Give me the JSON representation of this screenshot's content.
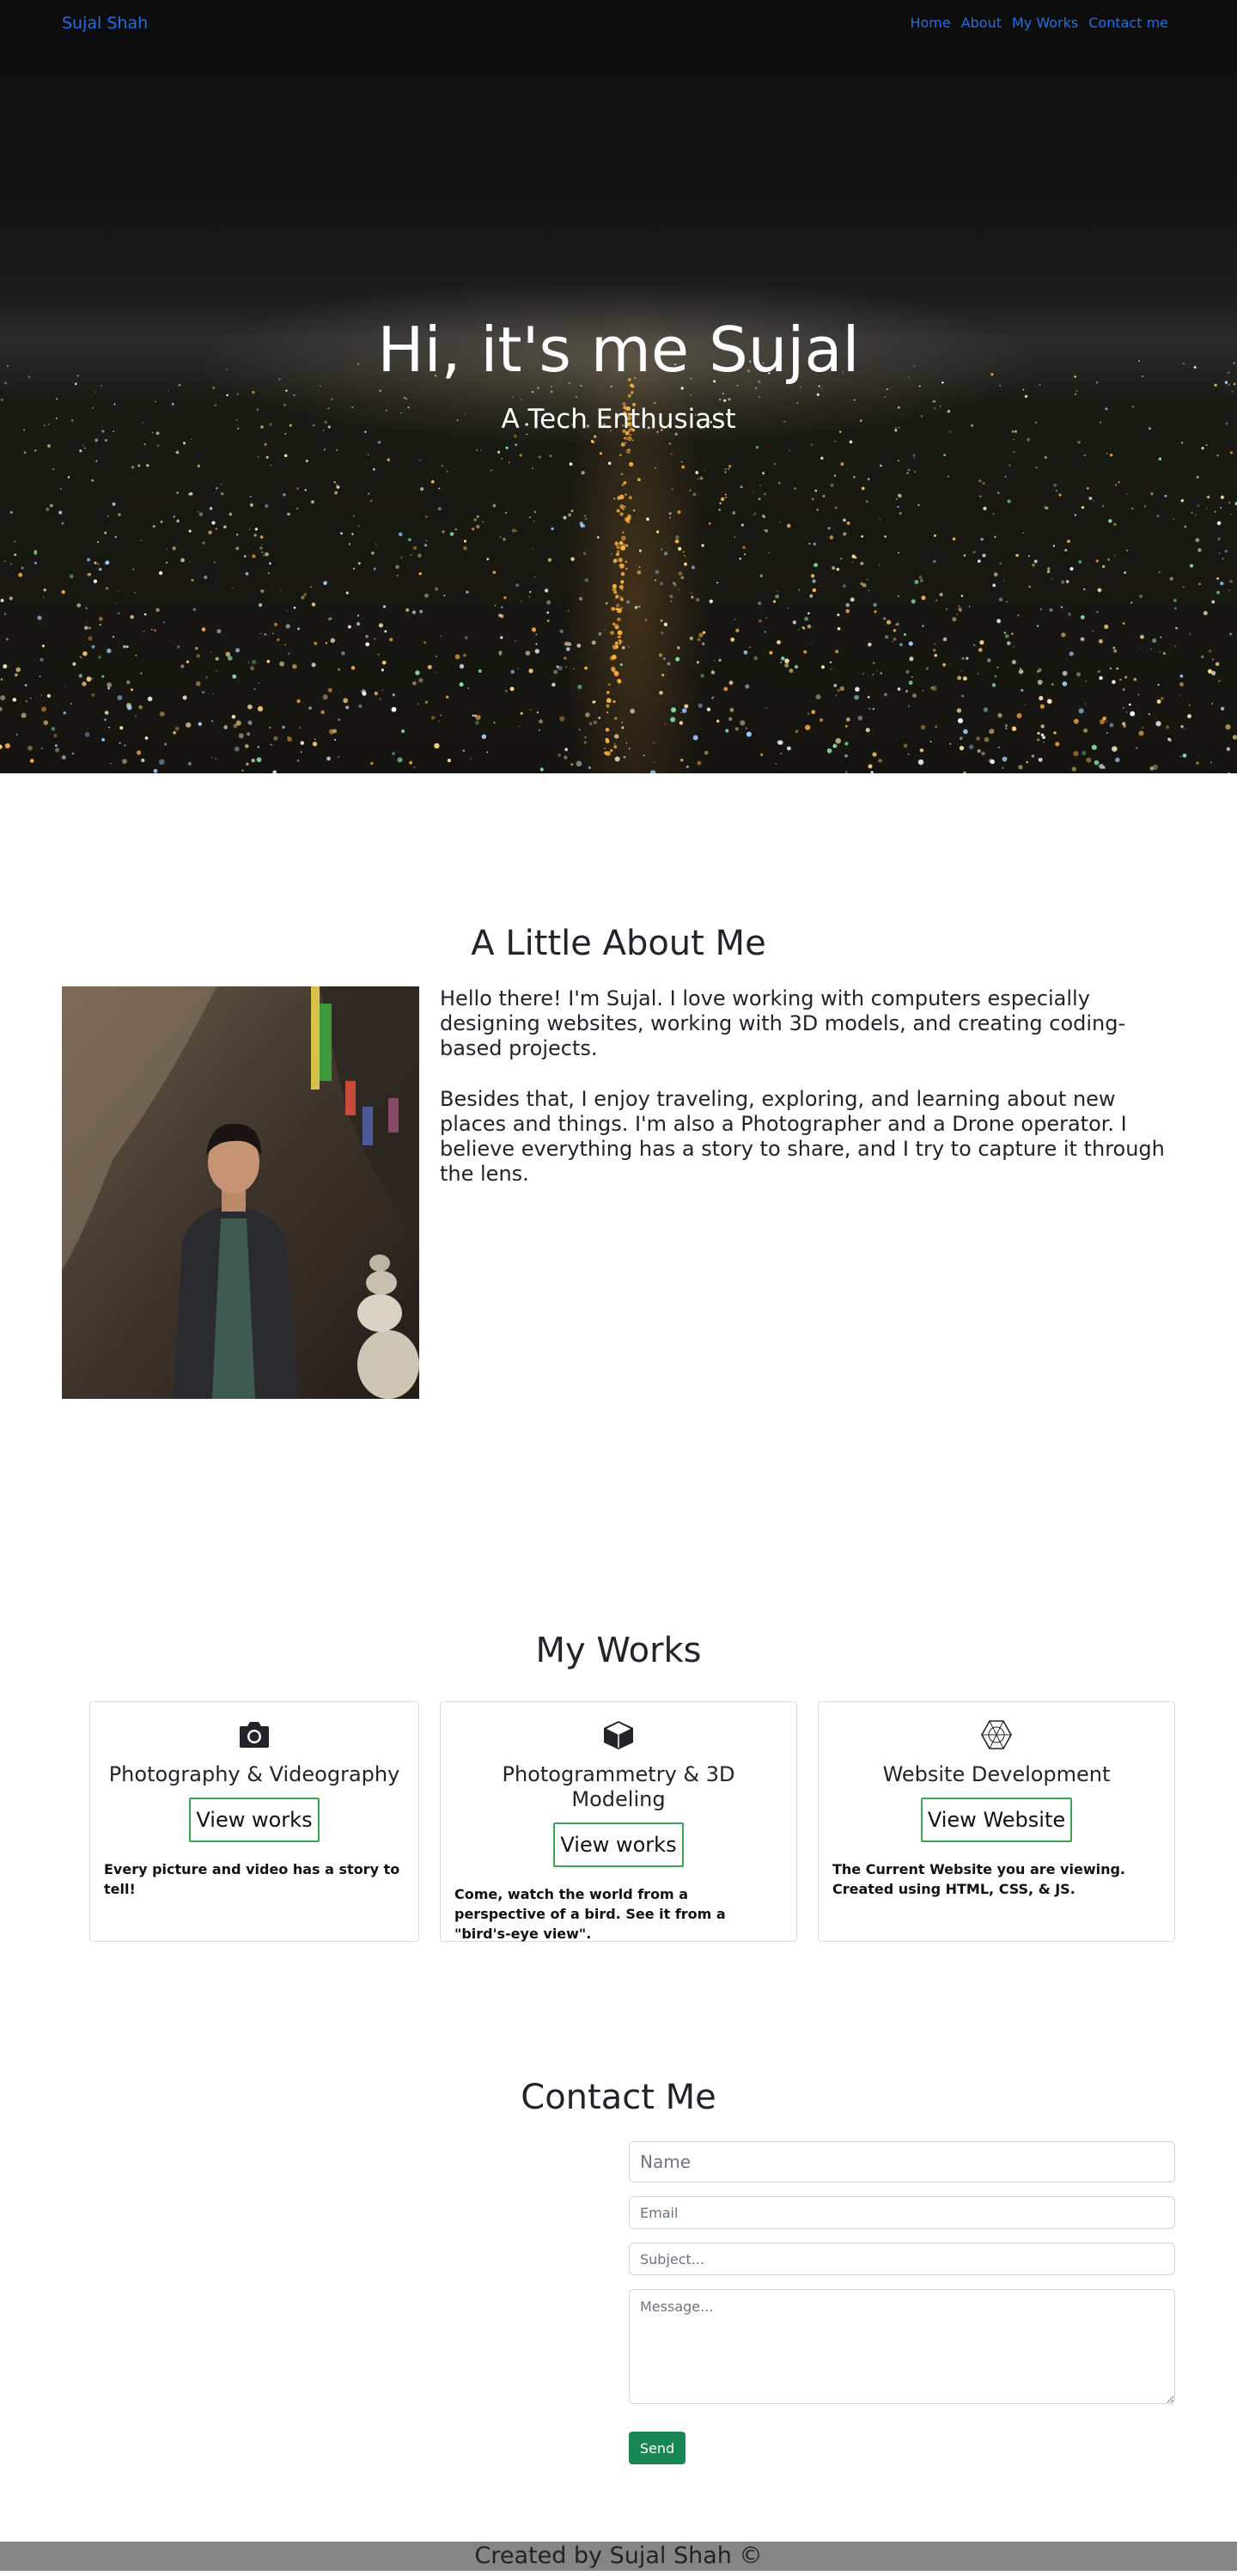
{
  "nav": {
    "brand": "Sujal Shah",
    "links": [
      "Home",
      "About",
      "My Works",
      "Contact me"
    ]
  },
  "hero": {
    "title": "Hi, it's me Sujal",
    "subtitle": "A Tech Enthusiast"
  },
  "about": {
    "title": "A Little About Me",
    "paragraphs": [
      "Hello there! I'm Sujal. I love working with computers especially designing websites, working with 3D models, and creating coding-based projects.",
      "Besides that, I enjoy traveling, exploring, and learning about new places and things. I'm also a Photographer and a Drone operator. I believe everything has a story to share, and I try to capture it through the lens."
    ]
  },
  "works": {
    "title": "My Works",
    "cards": [
      {
        "icon": "camera-icon",
        "title": "Photography & Videography",
        "button": "View works",
        "text": "Every picture and video has a story to tell!"
      },
      {
        "icon": "cube-icon",
        "title": "Photogrammetry & 3D Modeling",
        "button": "View works",
        "text": "Come, watch the world from a perspective of a bird. See it from a \"bird's-eye view\"."
      },
      {
        "icon": "web-icon",
        "title": "Website Development",
        "button": "View Website",
        "text": "The Current Website you are viewing. Created using HTML, CSS, & JS."
      }
    ]
  },
  "contact": {
    "title": "Contact Me",
    "name_placeholder": "Name",
    "email_placeholder": "Email",
    "subject_placeholder": "Subject...",
    "message_placeholder": "Message...",
    "send_label": "Send"
  },
  "footer": {
    "text": "Created by Sujal Shah ©"
  },
  "colors": {
    "link": "#1f6fe5",
    "send_button": "#198754",
    "card_button_border": "#3aa655",
    "footer_bg": "#858585"
  }
}
